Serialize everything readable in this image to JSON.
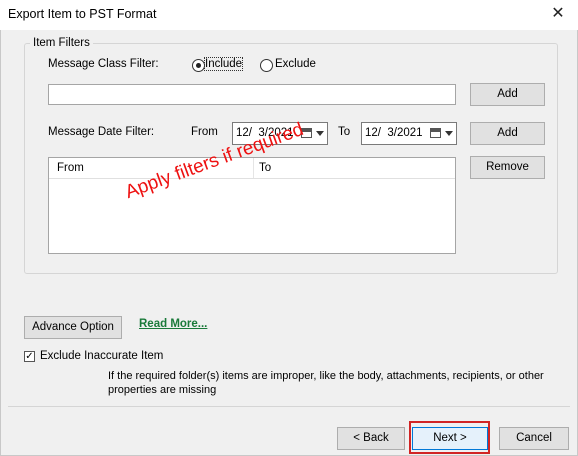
{
  "window": {
    "title": "Export Item to PST Format",
    "close_glyph": "✕"
  },
  "filters": {
    "group_label": "Item Filters",
    "class_filter_label": "Message Class Filter:",
    "include_label": "Include",
    "exclude_label": "Exclude",
    "selected": "Include",
    "class_input_value": "",
    "add_class_label": "Add",
    "date_filter_label": "Message Date Filter:",
    "from_label": "From",
    "from_date": "12/  3/2021",
    "to_label": "To",
    "to_date": "12/  3/2021",
    "add_date_label": "Add",
    "remove_label": "Remove",
    "list_columns": [
      "From",
      "To"
    ],
    "list_rows": []
  },
  "annotation": {
    "text": "Apply filters if required",
    "color": "#e11111"
  },
  "advance_option_label": "Advance Option",
  "read_more_label": "Read More...",
  "exclude_inaccurate": {
    "label": "Exclude Inaccurate Item",
    "checked": true,
    "check_glyph": "✓",
    "note": "If the required folder(s) items are improper, like the body, attachments, recipients, or other properties are missing"
  },
  "footer": {
    "back_label": "< Back",
    "next_label": "Next >",
    "cancel_label": "Cancel",
    "highlight_color": "#d12424"
  }
}
